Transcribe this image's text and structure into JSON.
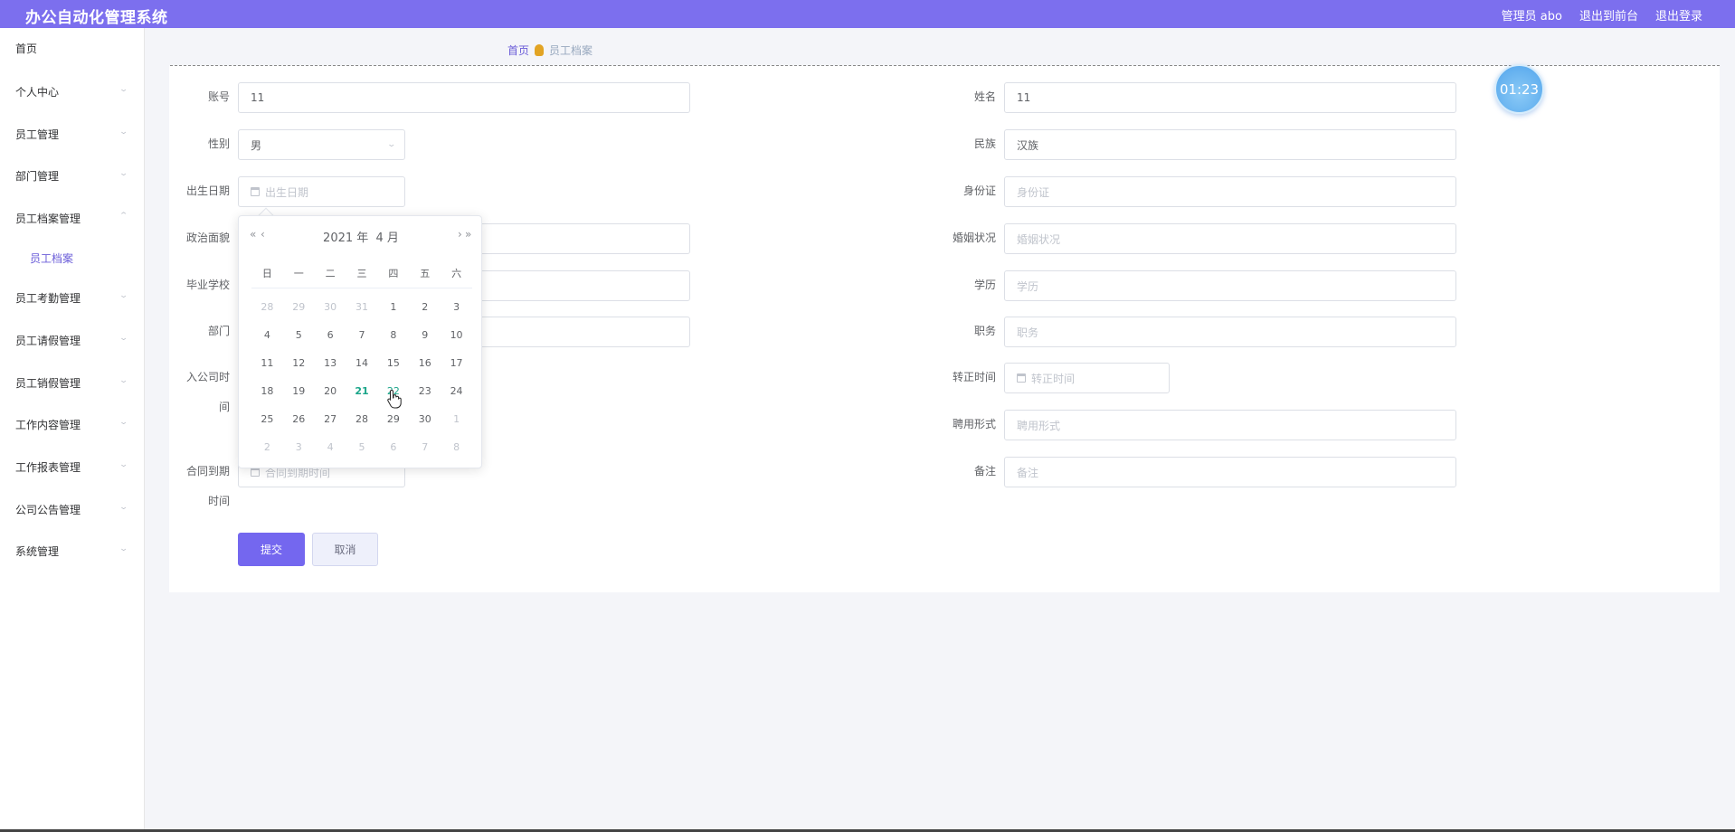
{
  "app": {
    "title": "办公自动化管理系统"
  },
  "topnav": {
    "user": "管理员 abo",
    "front": "退出到前台",
    "logout": "退出登录"
  },
  "sidebar": {
    "items": [
      {
        "label": "首页"
      },
      {
        "label": "个人中心"
      },
      {
        "label": "员工管理"
      },
      {
        "label": "部门管理"
      },
      {
        "label": "员工档案管理"
      },
      {
        "label": "员工档案"
      },
      {
        "label": "员工考勤管理"
      },
      {
        "label": "员工请假管理"
      },
      {
        "label": "员工销假管理"
      },
      {
        "label": "工作内容管理"
      },
      {
        "label": "工作报表管理"
      },
      {
        "label": "公司公告管理"
      },
      {
        "label": "系统管理"
      }
    ]
  },
  "breadcrumb": {
    "home": "首页",
    "current": "员工档案"
  },
  "timer": "01:23",
  "form": {
    "account": {
      "label": "账号",
      "value": "11"
    },
    "name": {
      "label": "姓名",
      "value": "11"
    },
    "gender": {
      "label": "性别",
      "value": "男"
    },
    "ethnicity": {
      "label": "民族",
      "value": "汉族"
    },
    "birthdate": {
      "label": "出生日期",
      "placeholder": "出生日期"
    },
    "idcard": {
      "label": "身份证",
      "placeholder": "身份证"
    },
    "political": {
      "label": "政治面貌"
    },
    "marital": {
      "label": "婚姻状况",
      "placeholder": "婚姻状况"
    },
    "school": {
      "label": "毕业学校"
    },
    "education": {
      "label": "学历",
      "placeholder": "学历"
    },
    "department": {
      "label": "部门"
    },
    "position": {
      "label": "职务",
      "placeholder": "职务"
    },
    "join_date": {
      "label_line1": "入公司时",
      "label_line2": "间"
    },
    "regular_date": {
      "label": "转正时间",
      "placeholder": "转正时间"
    },
    "employment": {
      "label": "聘用形式",
      "placeholder": "聘用形式"
    },
    "contract_end": {
      "label_line1": "合同到期",
      "label_line2": "时间",
      "placeholder": "合同到期时间"
    },
    "remark": {
      "label": "备注",
      "placeholder": "备注"
    },
    "submit": "提交",
    "cancel": "取消"
  },
  "datepicker": {
    "prev_year": "«",
    "prev_month": "‹",
    "next_month": "›",
    "next_year": "»",
    "year": "2021 年",
    "month": "4 月",
    "weekdays": [
      "日",
      "一",
      "二",
      "三",
      "四",
      "五",
      "六"
    ],
    "days": [
      {
        "d": "28",
        "muted": true
      },
      {
        "d": "29",
        "muted": true
      },
      {
        "d": "30",
        "muted": true
      },
      {
        "d": "31",
        "muted": true
      },
      {
        "d": "1"
      },
      {
        "d": "2"
      },
      {
        "d": "3"
      },
      {
        "d": "4"
      },
      {
        "d": "5"
      },
      {
        "d": "6"
      },
      {
        "d": "7"
      },
      {
        "d": "8"
      },
      {
        "d": "9"
      },
      {
        "d": "10"
      },
      {
        "d": "11"
      },
      {
        "d": "12"
      },
      {
        "d": "13"
      },
      {
        "d": "14"
      },
      {
        "d": "15"
      },
      {
        "d": "16"
      },
      {
        "d": "17"
      },
      {
        "d": "18"
      },
      {
        "d": "19"
      },
      {
        "d": "20"
      },
      {
        "d": "21",
        "today": true
      },
      {
        "d": "22",
        "hover": true
      },
      {
        "d": "23"
      },
      {
        "d": "24"
      },
      {
        "d": "25"
      },
      {
        "d": "26"
      },
      {
        "d": "27"
      },
      {
        "d": "28"
      },
      {
        "d": "29"
      },
      {
        "d": "30"
      },
      {
        "d": "1",
        "muted": true
      },
      {
        "d": "2",
        "muted": true
      },
      {
        "d": "3",
        "muted": true
      },
      {
        "d": "4",
        "muted": true
      },
      {
        "d": "5",
        "muted": true
      },
      {
        "d": "6",
        "muted": true
      },
      {
        "d": "7",
        "muted": true
      },
      {
        "d": "8",
        "muted": true
      }
    ]
  }
}
